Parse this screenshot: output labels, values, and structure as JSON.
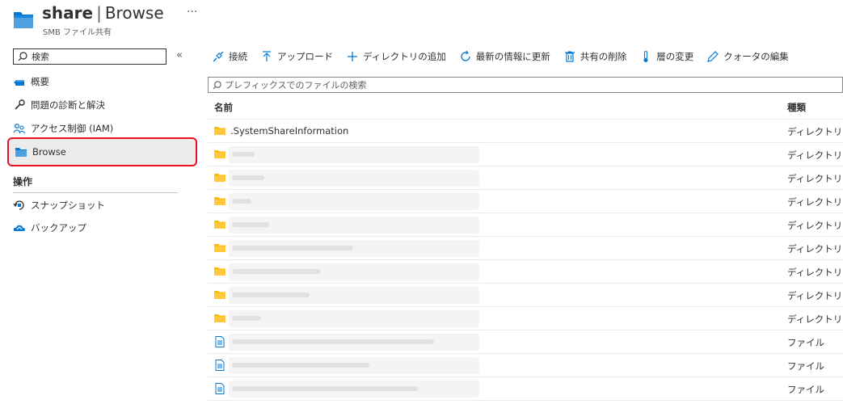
{
  "header": {
    "title": "share",
    "separator": "|",
    "page": "Browse",
    "ellipsis": "···",
    "subtitle": "SMB ファイル共有",
    "icon": "folder-share-icon"
  },
  "sidebar": {
    "search_placeholder": "検索",
    "collapse": "«",
    "items": [
      {
        "label": "概要",
        "icon": "overview-icon"
      },
      {
        "label": "問題の診断と解決",
        "icon": "wrench-icon"
      },
      {
        "label": "アクセス制御 (IAM)",
        "icon": "people-icon"
      },
      {
        "label": "Browse",
        "icon": "folder-icon"
      }
    ],
    "section_label": "操作",
    "ops": [
      {
        "label": "スナップショット",
        "icon": "snapshot-icon"
      },
      {
        "label": "バックアップ",
        "icon": "backup-cloud-icon"
      }
    ]
  },
  "toolbar": {
    "connect": "接続",
    "upload": "アップロード",
    "add_dir": "ディレクトリの追加",
    "refresh": "最新の情報に更新",
    "delete_share": "共有の削除",
    "change_tier": "層の変更",
    "edit_quota": "クォータの編集"
  },
  "file_search": {
    "placeholder": "プレフィックスでのファイルの検索"
  },
  "table": {
    "col_name": "名前",
    "col_type": "種類",
    "rows": [
      {
        "name": ".SystemShareInformation",
        "type": "ディレクトリ",
        "kind": "folder"
      },
      {
        "name": "",
        "type": "ディレクトリ",
        "kind": "folder"
      },
      {
        "name": "",
        "type": "ディレクトリ",
        "kind": "folder"
      },
      {
        "name": "",
        "type": "ディレクトリ",
        "kind": "folder"
      },
      {
        "name": "",
        "type": "ディレクトリ",
        "kind": "folder"
      },
      {
        "name": "",
        "type": "ディレクトリ",
        "kind": "folder"
      },
      {
        "name": "",
        "type": "ディレクトリ",
        "kind": "folder"
      },
      {
        "name": "",
        "type": "ディレクトリ",
        "kind": "folder"
      },
      {
        "name": "",
        "type": "ディレクトリ",
        "kind": "folder"
      },
      {
        "name": "",
        "type": "ファイル",
        "kind": "file"
      },
      {
        "name": "",
        "type": "ファイル",
        "kind": "file"
      },
      {
        "name": "",
        "type": "ファイル",
        "kind": "file"
      }
    ]
  },
  "colors": {
    "accent": "#0078d4",
    "folder": "#ffb900",
    "highlight_border": "#e81123"
  }
}
